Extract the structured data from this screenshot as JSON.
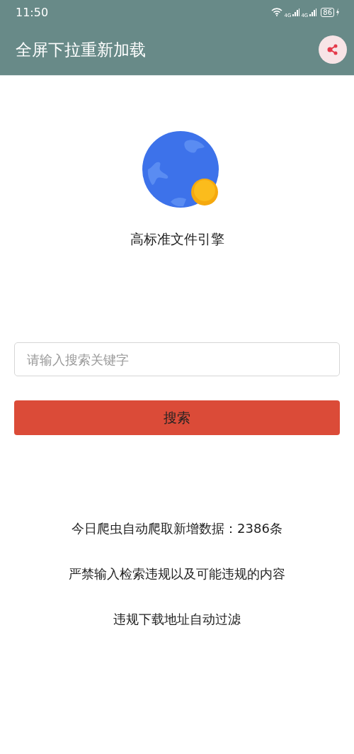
{
  "status_bar": {
    "time": "11:50",
    "network_1": "4G",
    "network_2": "4G",
    "battery": "86"
  },
  "app_bar": {
    "title": "全屏下拉重新加载"
  },
  "logo": {
    "caption": "高标准文件引擎"
  },
  "search": {
    "placeholder": "请输入搜索关键字",
    "button": "搜索"
  },
  "notices": [
    "今日爬虫自动爬取新增数据：2386条",
    "严禁输入检索违规以及可能违规的内容",
    "违规下载地址自动过滤"
  ]
}
